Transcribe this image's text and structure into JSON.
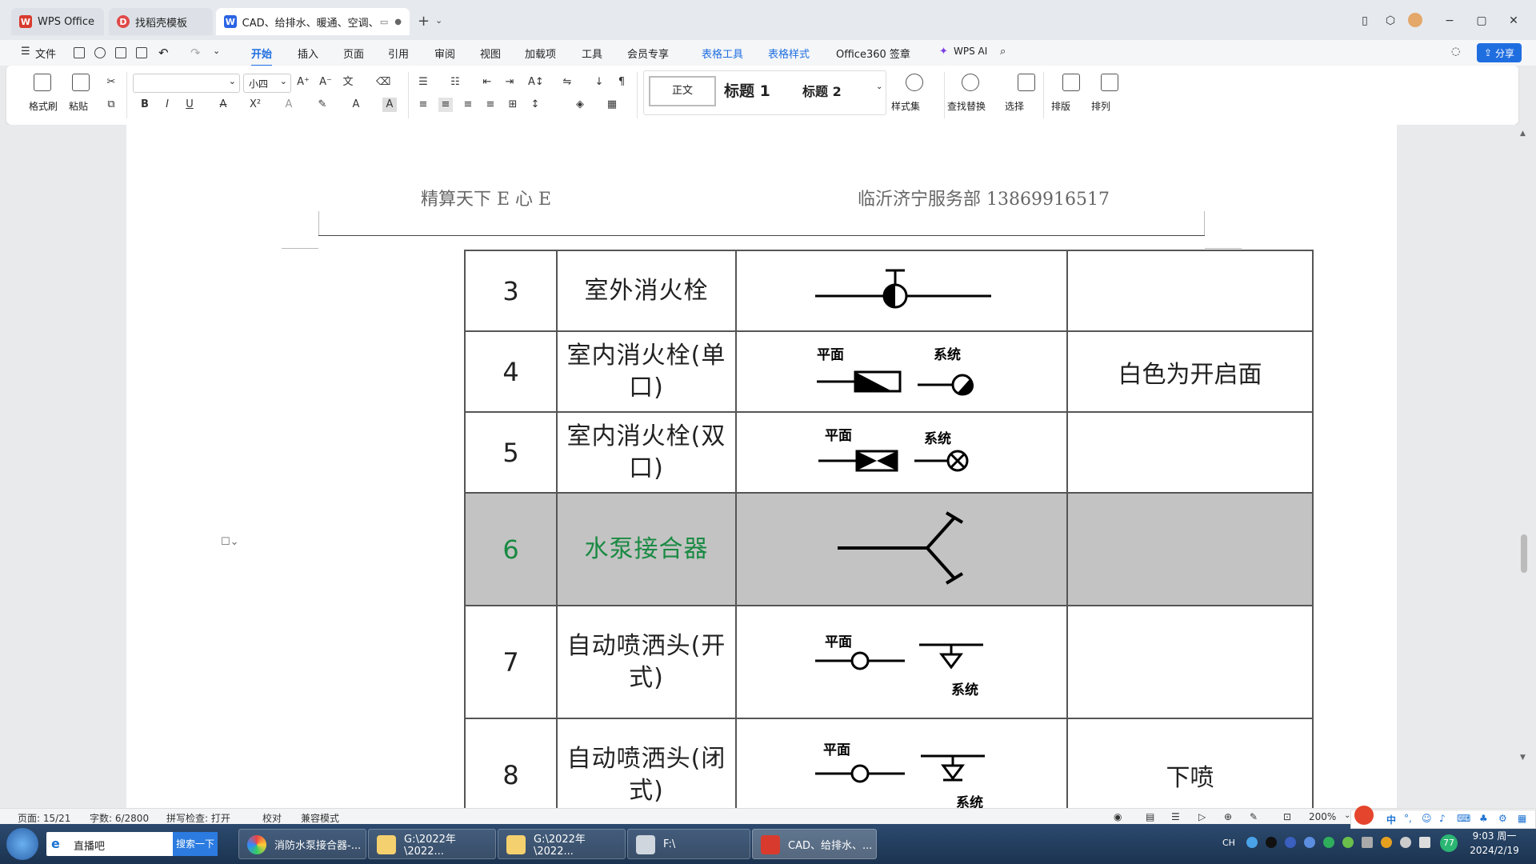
{
  "tabs": [
    {
      "label": "WPS Office"
    },
    {
      "label": "找稻壳模板"
    },
    {
      "label": "CAD、给排水、暖通、空调、..."
    }
  ],
  "menu": {
    "file": "文件",
    "items": [
      "开始",
      "插入",
      "页面",
      "引用",
      "审阅",
      "视图",
      "加载项",
      "工具",
      "会员专享",
      "表格工具",
      "表格样式",
      "Office360 签章"
    ],
    "wps_ai": "WPS AI",
    "share": "分享"
  },
  "ribbon": {
    "format_painter": "格式刷",
    "paste": "粘贴",
    "font_name": "",
    "font_size": "小四",
    "styles": [
      "正文",
      "标题 1",
      "标题 2"
    ],
    "style_set": "样式集",
    "find_replace": "查找替换",
    "select": "选择",
    "layout": "排版",
    "arrange": "排列"
  },
  "document": {
    "header_left": "精算天下 E 心 E",
    "header_right": "临沂济宁服务部 13869916517",
    "rows": [
      {
        "num": "3",
        "name": "室外消火栓",
        "symbol": "outdoor-hydrant",
        "note": ""
      },
      {
        "num": "4",
        "name": "室内消火栓(单口)",
        "symbol": "indoor-hydrant-single",
        "note": "白色为开启面",
        "labels": [
          "平面",
          "系统"
        ]
      },
      {
        "num": "5",
        "name": "室内消火栓(双口)",
        "symbol": "indoor-hydrant-double",
        "note": "",
        "labels": [
          "平面",
          "系统"
        ]
      },
      {
        "num": "6",
        "name": "水泵接合器",
        "symbol": "pump-adapter",
        "note": "",
        "highlighted": true
      },
      {
        "num": "7",
        "name": "自动喷洒头(开式)",
        "symbol": "sprinkler-open",
        "note": "",
        "labels": [
          "平面",
          "系统"
        ]
      },
      {
        "num": "8",
        "name": "自动喷洒头(闭式)",
        "symbol": "sprinkler-closed",
        "note": "下喷",
        "labels": [
          "平面",
          "系统"
        ]
      }
    ]
  },
  "status": {
    "page": "页面: 15/21",
    "words": "字数: 6/2800",
    "spell": "拼写检查: 打开",
    "proof": "校对",
    "compat": "兼容模式",
    "zoom": "200%"
  },
  "taskbar": {
    "search_label": "直播吧",
    "search_button": "搜索一下",
    "items": [
      "消防水泵接合器-...",
      "G:\\2022年\\2022...",
      "G:\\2022年\\2022...",
      "F:\\",
      "CAD、给排水、..."
    ],
    "lang": "CH",
    "time": "9:03 周一",
    "date": "2024/2/19",
    "badge": "77"
  },
  "colors": {
    "accent": "#1f6ee0",
    "highlight_text": "#1a8a43",
    "highlight_row": "#c3c3c3",
    "wps_red": "#d83b2e"
  }
}
